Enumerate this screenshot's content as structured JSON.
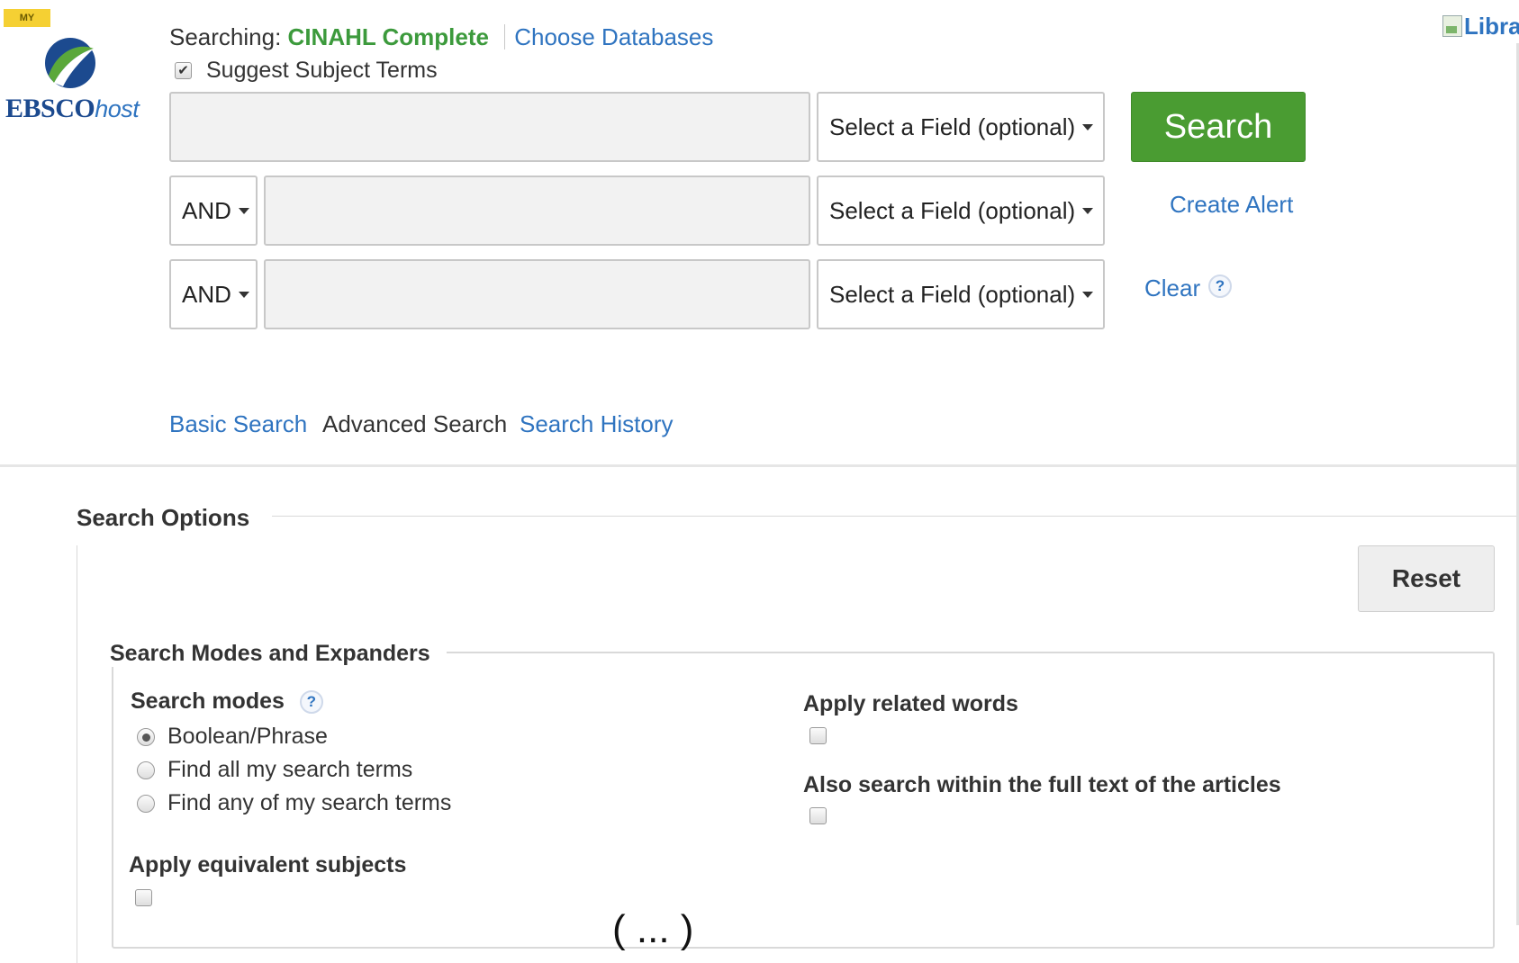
{
  "header": {
    "my_badge": "MY",
    "logo": {
      "brand": "EBSCO",
      "suffix": "host"
    },
    "library_image_alt": "Libra",
    "searching_label": "Searching:",
    "database_name": "CINAHL Complete",
    "choose_databases": "Choose Databases",
    "suggest_subject_terms": {
      "label": "Suggest Subject Terms",
      "checked": true
    }
  },
  "search_rows": [
    {
      "operator": null,
      "value": "",
      "field": "Select a Field (optional)"
    },
    {
      "operator": "AND",
      "value": "",
      "field": "Select a Field (optional)"
    },
    {
      "operator": "AND",
      "value": "",
      "field": "Select a Field (optional)"
    }
  ],
  "actions": {
    "search": "Search",
    "create_alert": "Create Alert",
    "clear": "Clear",
    "help": "?"
  },
  "nav": {
    "basic_search": "Basic Search",
    "advanced_search": "Advanced Search",
    "search_history": "Search History",
    "current": "advanced_search"
  },
  "search_options": {
    "title": "Search Options",
    "reset": "Reset",
    "modes_and_expanders": {
      "title": "Search Modes and Expanders",
      "search_modes": {
        "label": "Search modes",
        "help": "?",
        "options": [
          "Boolean/Phrase",
          "Find all my search terms",
          "Find any of my search terms"
        ],
        "selected_index": 0
      },
      "apply_related_words": {
        "label": "Apply related words",
        "checked": false
      },
      "full_text": {
        "label": "Also search within the full text of the articles",
        "checked": false
      },
      "apply_equivalent_subjects": {
        "label": "Apply equivalent subjects",
        "checked": false
      }
    }
  },
  "truncation_marker": "( ... )",
  "colors": {
    "link": "#2f74c0",
    "database": "#3c9a3c",
    "search_button": "#4a9c32",
    "brand_blue": "#1c4a8f"
  }
}
